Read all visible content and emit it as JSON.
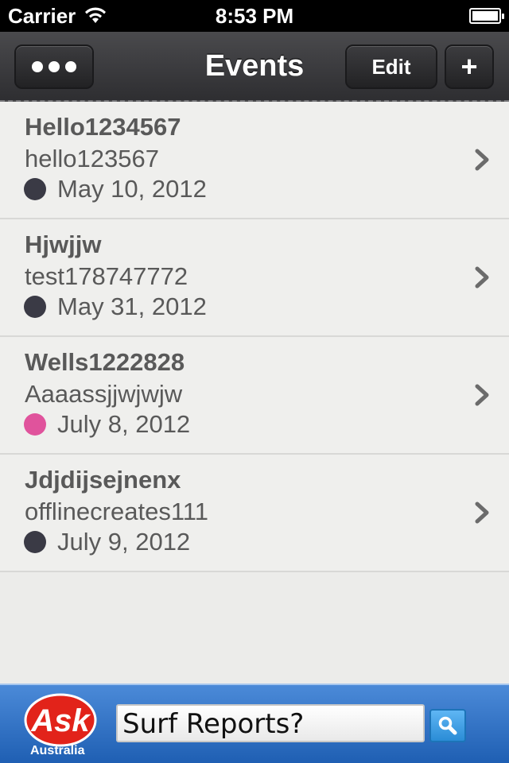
{
  "status_bar": {
    "carrier": "Carrier",
    "time": "8:53 PM",
    "wifi_icon": "wifi-icon",
    "battery_icon": "battery-icon"
  },
  "nav": {
    "title": "Events",
    "menu_icon": "more-dots-icon",
    "edit_label": "Edit",
    "add_label": "+"
  },
  "events": [
    {
      "title": "Hello1234567",
      "subtitle": "hello123567",
      "date": "May 10, 2012",
      "color": "#3a3a45"
    },
    {
      "title": "Hjwjjw",
      "subtitle": "test178747772",
      "date": "May 31, 2012",
      "color": "#3a3a45"
    },
    {
      "title": "Wells1222828",
      "subtitle": "Aaaassjjwjwjw",
      "date": "July 8, 2012",
      "color": "#e0539c"
    },
    {
      "title": "Jdjdijsejnenx",
      "subtitle": "offlinecreates111",
      "date": "July 9, 2012",
      "color": "#3a3a45"
    }
  ],
  "ad": {
    "brand": "Ask",
    "region": "Australia",
    "search_value": "Surf Reports?",
    "search_icon": "magnifier-icon"
  }
}
